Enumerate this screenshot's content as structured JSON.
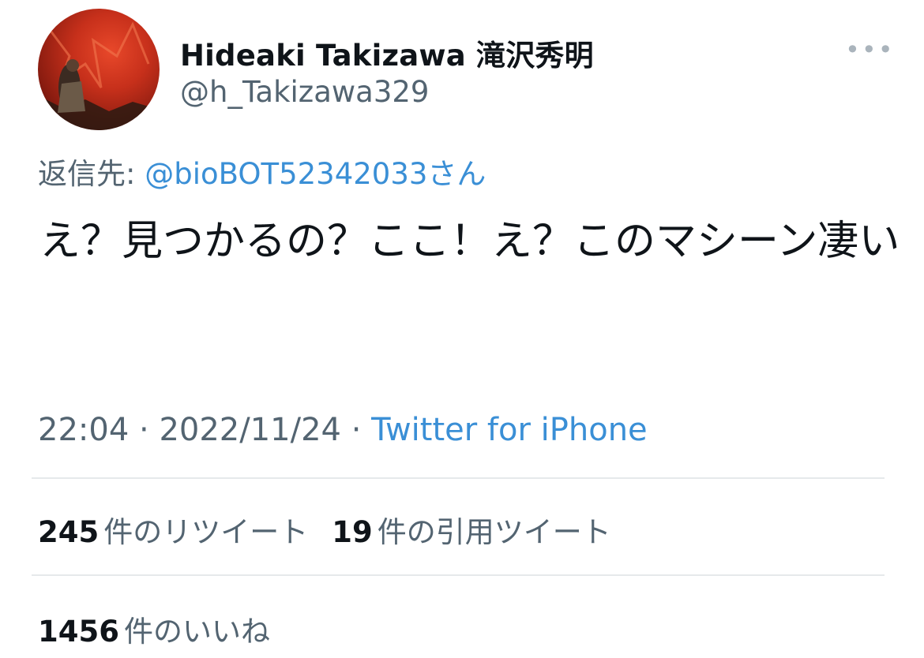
{
  "author": {
    "display_name": "Hideaki Takizawa 滝沢秀明",
    "handle": "@h_Takizawa329",
    "avatar": "avatar-photo"
  },
  "more_label": "•••",
  "reply": {
    "prefix": "返信先: ",
    "mention": "@bioBOT52342033",
    "suffix": "さん"
  },
  "tweet": {
    "text": "え？見つかるの？ここ！え？このマシーン凄い"
  },
  "meta": {
    "time": "22:04",
    "sep1": " · ",
    "date": "2022/11/24",
    "sep2": " · ",
    "source": "Twitter for iPhone"
  },
  "stats": {
    "retweets_count": "245",
    "retweets_label": "件のリツイート",
    "quotes_count": "19",
    "quotes_label": "件の引用ツイート",
    "likes_count": "1456",
    "likes_label": "件のいいね"
  },
  "colors": {
    "link": "#3a8fd6",
    "secondary": "#536471",
    "primary": "#0f1419"
  }
}
